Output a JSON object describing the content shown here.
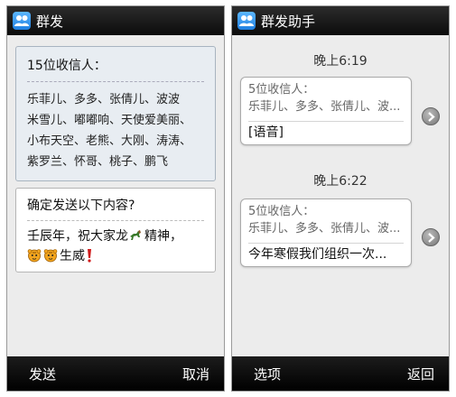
{
  "left": {
    "title": "群发",
    "recipients_title": "15位收信人：",
    "recipient_lines": [
      "乐菲儿、多多、张倩儿、波波",
      "米雪儿、嘟嘟响、天使爱美丽、",
      "小布天空、老熊、大刚、涛涛、",
      "紫罗兰、怀哥、桃子、鹏飞"
    ],
    "confirm_title": "确定发送以下内容?",
    "message_line1": "壬辰年，祝大家龙",
    "message_line1_end": "精神，",
    "message_line2_end": "生威",
    "emoji": [
      "horse-emoji",
      "tiger-emoji",
      "tiger-emoji",
      "exclamation-emoji"
    ],
    "softkeys": {
      "left": "发送",
      "right": "取消"
    }
  },
  "right": {
    "title": "群发助手",
    "messages": [
      {
        "time": "晚上6:19",
        "head": "5位收信人：",
        "recipients": "乐菲儿、多多、张倩儿、波...",
        "body": "[语音]"
      },
      {
        "time": "晚上6:22",
        "head": "5位收信人：",
        "recipients": "乐菲儿、多多、张倩儿、波...",
        "body": "今年寒假我们组织一次..."
      }
    ],
    "softkeys": {
      "left": "选项",
      "right": "返回"
    }
  },
  "colors": {
    "titlebar": "#111111",
    "screen_bg": "#ececec",
    "recipients_bg": "#e8edf2",
    "app_icon": "#3a9bf0"
  },
  "icons": [
    "group-chat-icon",
    "chevron-right-icon"
  ]
}
